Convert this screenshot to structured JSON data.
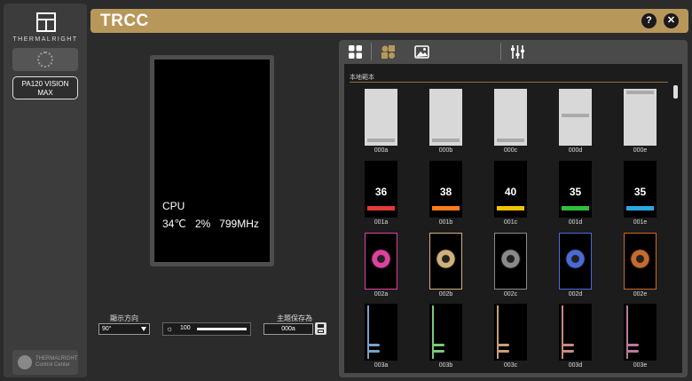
{
  "app": {
    "logo_text": "THERMALRIGHT",
    "device_button": "PA120 VISION MAX",
    "tcc_label": "THERMALRIGHT Control Center",
    "title": "TRCC",
    "help_icon": "question-icon",
    "close_icon": "close-icon"
  },
  "preview": {
    "label": "CPU",
    "temp": "34℃",
    "usage": "2%",
    "freq": "799MHz"
  },
  "controls": {
    "rotation_label": "顯示方向",
    "rotation_value": "90°",
    "brightness_value": "100",
    "brightness_fraction": 1.0,
    "save_label": "主題保存為",
    "save_value": "000a"
  },
  "toolbar": {
    "icons": [
      "grid-icon",
      "shapes-icon",
      "image-icon",
      "sliders-icon"
    ]
  },
  "gallery": {
    "section_title": "本地範本",
    "rows": [
      [
        {
          "label": "000a",
          "style": "light"
        },
        {
          "label": "000b",
          "style": "light"
        },
        {
          "label": "000c",
          "style": "light"
        },
        {
          "label": "000d",
          "style": "light"
        },
        {
          "label": "000e",
          "style": "light"
        }
      ],
      [
        {
          "label": "001a",
          "style": "number",
          "num": "36",
          "color": "#e53935"
        },
        {
          "label": "001b",
          "style": "number",
          "num": "38",
          "color": "#ff7a1a"
        },
        {
          "label": "001c",
          "style": "number",
          "num": "40",
          "color": "#f2c200"
        },
        {
          "label": "001d",
          "style": "number",
          "num": "35",
          "color": "#2fbf3a"
        },
        {
          "label": "001e",
          "style": "number",
          "num": "35",
          "color": "#29a8e0"
        }
      ],
      [
        {
          "label": "002a",
          "style": "gear",
          "color": "#e040a0"
        },
        {
          "label": "002b",
          "style": "gear",
          "color": "#d2b07a"
        },
        {
          "label": "002c",
          "style": "gear",
          "color": "#8a8a8a"
        },
        {
          "label": "002d",
          "style": "gear",
          "color": "#4a6ad8"
        },
        {
          "label": "002e",
          "style": "gear",
          "color": "#c86a2a"
        }
      ],
      [
        {
          "label": "003a",
          "style": "pill",
          "color": "#7aa0c8"
        },
        {
          "label": "003b",
          "style": "pill",
          "color": "#7ac87a"
        },
        {
          "label": "003c",
          "style": "pill",
          "color": "#c8a07a"
        },
        {
          "label": "003d",
          "style": "pill",
          "color": "#c88a7a"
        },
        {
          "label": "003e",
          "style": "pill",
          "color": "#b87aa0"
        }
      ]
    ]
  }
}
